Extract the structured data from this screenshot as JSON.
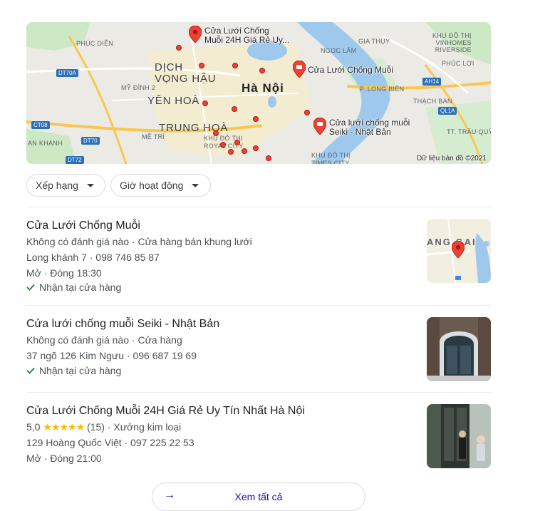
{
  "map": {
    "labels": {
      "phuc_dien": "PHÚC DIỄN",
      "dich_vong_hau": "DỊCH\nVỌNG HẬU",
      "my_dinh": "MỸ ĐÌNH 2",
      "yen_hoa": "YÊN HOÀ",
      "trung_hoa": "TRUNG HOÀ",
      "ha_noi": "Hà Nội",
      "me_tri": "MỄ TRÌ",
      "khu_do_thi_royal": "KHU ĐÔ THỊ\nROYAL CITY",
      "khu_do_thi_times": "KHU ĐÔ THỊ\nTIMES CITY",
      "ngoc_lam": "NGỌC LÂM",
      "gia_thuy": "GIA THỤY",
      "vinhomes": "KHU ĐÔ THỊ\nVINHOMES\nRIVERSIDE",
      "phuc_loi": "PHÚC LỢI",
      "long_bien": "P. LONG BIÊN",
      "thach_ban": "THẠCH BÀN",
      "trau_quy": "TT. TRÂU QUỲ",
      "an_khanh": "AN KHÁNH"
    },
    "shields": {
      "dt70a": "DT70A",
      "ct08": "CT08",
      "dt70": "DT70",
      "dt72": "DT72",
      "ah14": "AH14",
      "ql1a": "QL1A"
    },
    "pins": {
      "pin1": "Cửa Lưới Chống\nMuỗi 24H Giá Rẻ Uy...",
      "pin2": "Cửa Lưới Chống Muỗi",
      "pin3": "Cửa lưới chống muỗi\nSeiki - Nhật Bản"
    },
    "attribution": "Dữ liệu bản đồ ©2021"
  },
  "filters": {
    "rating": "Xếp hạng",
    "hours": "Giờ hoạt động"
  },
  "results": [
    {
      "name": "Cửa Lưới Chống Muỗi",
      "line1": "Không có đánh giá nào · Cửa hàng bán khung lưới",
      "line2": "Long khánh 7 · 098 746 85 87",
      "line3": "Mở · Đóng 18:30",
      "line4": "Nhận tại cửa hàng"
    },
    {
      "name": "Cửa lưới chống muỗi Seiki - Nhật Bản",
      "line1": "Không có đánh giá nào · Cửa hàng",
      "line2": "37 ngõ 126 Kim Ngưu · 096 687 19 69",
      "line3": "Nhận tại cửa hàng"
    },
    {
      "name": "Cửa Lưới Chống Muỗi 24H Giá Rẻ Uy Tín Nhất Hà Nội",
      "rating": "5,0",
      "stars": "★★★★★",
      "reviews": "(15)",
      "category": "· Xưởng kim loại",
      "line2": "129 Hoàng Quốc Việt · 097 225 22 53",
      "line3": "Mở · Đóng 21:00"
    }
  ],
  "thumb1_text": "ANG GAI",
  "more_button": "Xem tất cả",
  "colors": {
    "accent_link": "#1a0dab",
    "pin_red": "#ea4335",
    "check_green": "#188038",
    "star": "#fbbc04"
  }
}
